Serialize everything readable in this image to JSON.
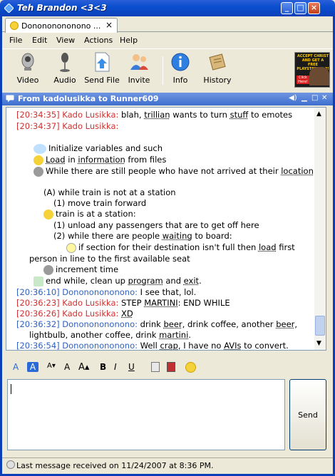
{
  "window": {
    "title": "Teh Brandon <3<3",
    "minimize": "_",
    "maximize": "□",
    "close": "×"
  },
  "tab": {
    "label": "Donononononono ...",
    "close": "×"
  },
  "menu": {
    "items": [
      "File",
      "Edit",
      "View",
      "Actions",
      "Help"
    ]
  },
  "toolbar": {
    "video": "Video",
    "audio": "Audio",
    "send_file": "Send File",
    "invite": "Invite",
    "info": "Info",
    "history": "History"
  },
  "ad": {
    "line1": "ACCEPT CHRIST",
    "line2": "AND GET A FREE",
    "line3": "PLAYSTATION 2!",
    "line4": "Click Here!"
  },
  "conversation": {
    "title": "From kadolusikka to Runner609"
  },
  "messages": [
    {
      "ts": "[20:34:35]",
      "who": "Kado Lusikka:",
      "pre": "blah, ",
      "link1": "trillian",
      "mid": " wants to turn ",
      "link2": "stuff",
      "post": " to emotes"
    },
    {
      "ts": "[20:34:37]",
      "who": "Kado Lusikka:"
    },
    {
      "text": "Initialize variables and such"
    },
    {
      "link": "Load",
      "mid": " in ",
      "link2": "information",
      "post": " from files"
    },
    {
      "pre": "While there are still people who have not arrived at their ",
      "link": "location",
      "post": ":"
    },
    {
      "text": "(A) while train is not at a station"
    },
    {
      "text": "(1) move train forward"
    },
    {
      "text": "train is at a station:"
    },
    {
      "text": "(1) unload any passengers that are to get off here"
    },
    {
      "pre": "(2) while there are people ",
      "link": "waiting",
      "post": " to board:"
    },
    {
      "pre": "if section for their destination isn't full then ",
      "link": "load",
      "post": " first"
    },
    {
      "text": "person in line to the first available seat"
    },
    {
      "text": "increment time"
    },
    {
      "pre": "end while, clean up ",
      "link": "program",
      "mid": " and ",
      "link2": "exit",
      "post": "."
    },
    {
      "ts": "[20:36:10]",
      "who": "Donononononono:",
      "text": "I see that, lol."
    },
    {
      "ts": "[20:36:23]",
      "who": "Kado Lusikka:",
      "pre": "STEP ",
      "link": "MARTINI",
      "post": ": END WHILE"
    },
    {
      "ts": "[20:36:26]",
      "who": "Kado Lusikka:",
      "link": "XD"
    },
    {
      "ts": "[20:36:32]",
      "who": "Donononononono:",
      "pre": "drink ",
      "link": "beer",
      "mid": ", drink coffee, another ",
      "link2": "beer",
      "post": ","
    },
    {
      "pre": "lightbulb, another coffee, drink ",
      "link": "martini",
      "post": "."
    },
    {
      "ts": "[20:36:54]",
      "who": "Donononononono:",
      "pre": "Well ",
      "link": "crap",
      "mid": ", I have no ",
      "link2": "AVIs",
      "post": " to convert."
    }
  ],
  "format": {
    "font_small": "A",
    "font_bg": "A",
    "size_down": "A",
    "size_norm": "A",
    "size_up": "A",
    "bold": "B",
    "italic": "I",
    "underline": "U"
  },
  "send": {
    "label": "Send"
  },
  "status": {
    "text": "Last message received on 11/24/2007 at 8:36 PM."
  }
}
